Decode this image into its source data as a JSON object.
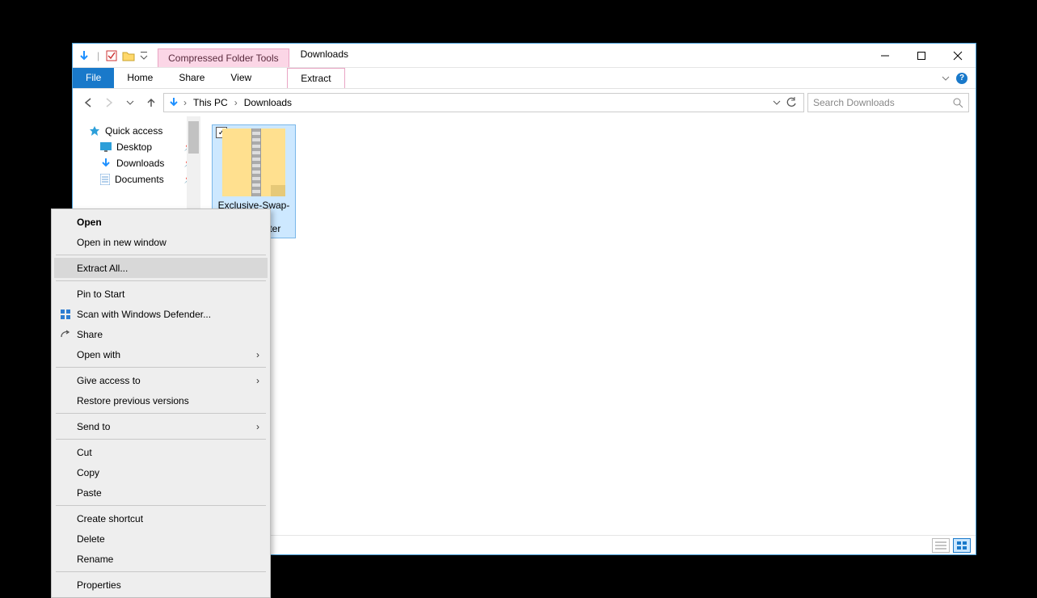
{
  "titlebar": {
    "context_tab": "Compressed Folder Tools",
    "title": "Downloads"
  },
  "ribbon": {
    "file": "File",
    "home": "Home",
    "share": "Share",
    "view": "View",
    "extract": "Extract"
  },
  "breadcrumb": {
    "root": "This PC",
    "current": "Downloads"
  },
  "search": {
    "placeholder": "Search Downloads"
  },
  "sidebar": {
    "quick_access": "Quick access",
    "items": [
      {
        "label": "Desktop"
      },
      {
        "label": "Downloads"
      },
      {
        "label": "Documents"
      }
    ]
  },
  "file": {
    "name_line1": "Exclusive-Swap-W",
    "name_line2": "idget-master"
  },
  "context_menu": {
    "open": "Open",
    "open_new_window": "Open in new window",
    "extract_all": "Extract All...",
    "pin_to_start": "Pin to Start",
    "scan_defender": "Scan with Windows Defender...",
    "share": "Share",
    "open_with": "Open with",
    "give_access_to": "Give access to",
    "restore_versions": "Restore previous versions",
    "send_to": "Send to",
    "cut": "Cut",
    "copy": "Copy",
    "paste": "Paste",
    "create_shortcut": "Create shortcut",
    "delete": "Delete",
    "rename": "Rename",
    "properties": "Properties"
  }
}
